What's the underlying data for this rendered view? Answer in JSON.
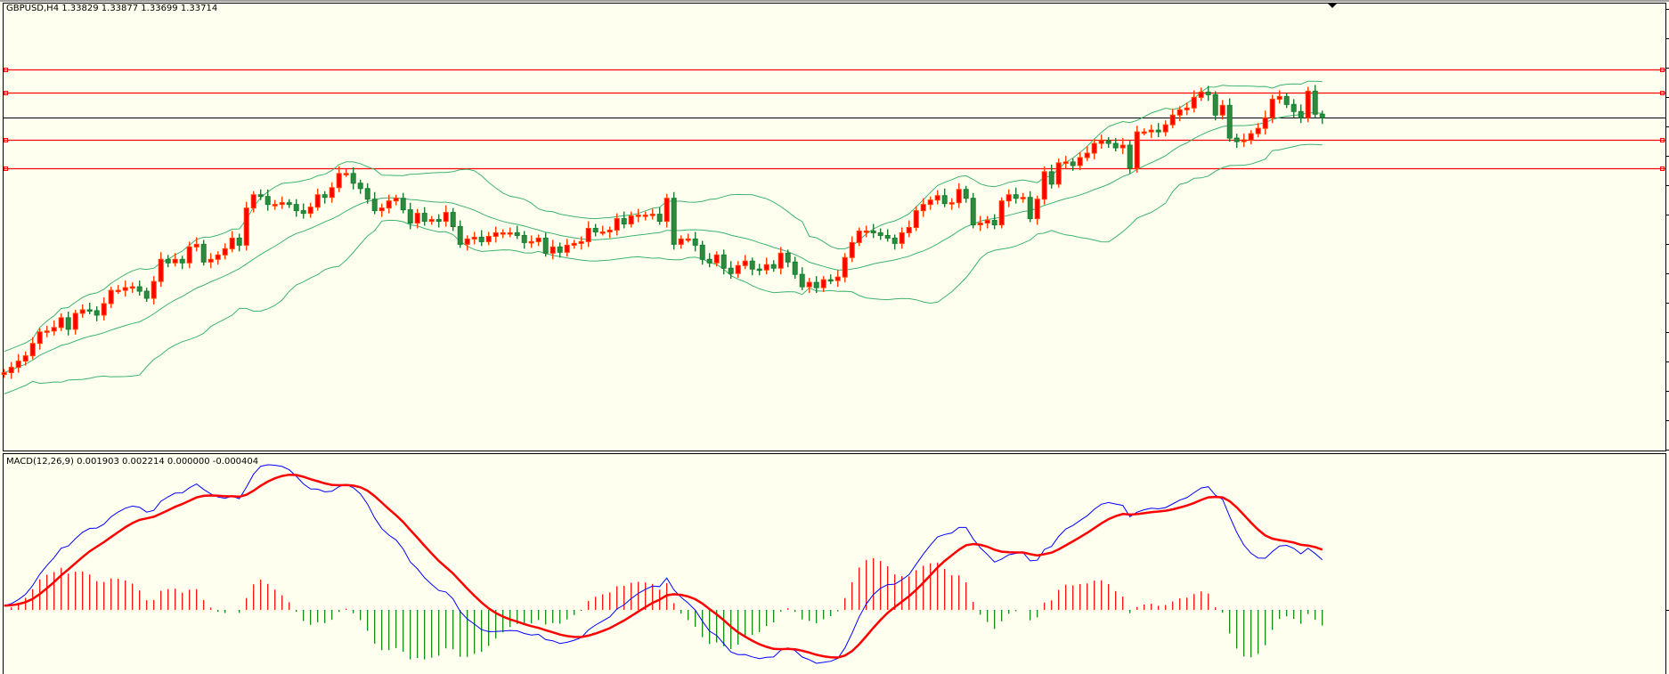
{
  "chart_data": {
    "type": "candlestick",
    "symbol_header": "GBPUSD,H4  1.33829 1.33877 1.33699 1.33714",
    "symbol": "GBPUSD",
    "timeframe": "H4",
    "ohlc_last": {
      "open": 1.33829,
      "high": 1.33877,
      "low": 1.33699,
      "close": 1.33714
    },
    "first_open": 1.3081,
    "closes": [
      1.3083,
      1.3089,
      1.3096,
      1.3102,
      1.3116,
      1.3129,
      1.313,
      1.3134,
      1.3145,
      1.3132,
      1.315,
      1.3154,
      1.3153,
      1.3148,
      1.3161,
      1.3176,
      1.3176,
      1.3179,
      1.318,
      1.3175,
      1.3167,
      1.3186,
      1.3211,
      1.3207,
      1.3211,
      1.3207,
      1.3225,
      1.3228,
      1.3208,
      1.3211,
      1.3216,
      1.3223,
      1.3235,
      1.3227,
      1.3269,
      1.3284,
      1.3282,
      1.3273,
      1.3273,
      1.3275,
      1.3273,
      1.3266,
      1.3263,
      1.327,
      1.3284,
      1.3281,
      1.3292,
      1.3308,
      1.3308,
      1.3297,
      1.3291,
      1.3279,
      1.3266,
      1.3269,
      1.3277,
      1.328,
      1.3267,
      1.3252,
      1.3263,
      1.3254,
      1.3256,
      1.3254,
      1.3264,
      1.3248,
      1.3228,
      1.3234,
      1.3236,
      1.3231,
      1.3237,
      1.3241,
      1.3241,
      1.3241,
      1.3238,
      1.323,
      1.3231,
      1.3235,
      1.3218,
      1.3225,
      1.3219,
      1.3227,
      1.3229,
      1.3231,
      1.3246,
      1.3242,
      1.3242,
      1.3244,
      1.3257,
      1.3251,
      1.326,
      1.3261,
      1.3261,
      1.3262,
      1.3254,
      1.328,
      1.3228,
      1.3234,
      1.3234,
      1.3227,
      1.3211,
      1.3207,
      1.3216,
      1.3201,
      1.3195,
      1.3204,
      1.3209,
      1.32,
      1.3199,
      1.3205,
      1.3201,
      1.3218,
      1.3208,
      1.3194,
      1.318,
      1.3185,
      1.3179,
      1.3188,
      1.3187,
      1.3191,
      1.3213,
      1.323,
      1.3243,
      1.3243,
      1.3241,
      1.3238,
      1.3235,
      1.3229,
      1.3241,
      1.3247,
      1.3266,
      1.3273,
      1.3278,
      1.3283,
      1.3274,
      1.3275,
      1.329,
      1.328,
      1.325,
      1.3252,
      1.3255,
      1.325,
      1.3277,
      1.3284,
      1.328,
      1.3281,
      1.3257,
      1.3279,
      1.331,
      1.3296,
      1.332,
      1.3321,
      1.3317,
      1.3326,
      1.3331,
      1.3342,
      1.3345,
      1.3342,
      1.3337,
      1.334,
      1.3314,
      1.3355,
      1.3355,
      1.3357,
      1.3355,
      1.3363,
      1.3374,
      1.338,
      1.3382,
      1.3394,
      1.34,
      1.3397,
      1.3374,
      1.3385,
      1.3348,
      1.3344,
      1.3346,
      1.3353,
      1.3359,
      1.3371,
      1.3392,
      1.3395,
      1.3386,
      1.3378,
      1.3371,
      1.3401,
      1.3375,
      1.3371
    ],
    "price_range": [
      1.2995,
      1.35
    ],
    "horizontal_lines": [
      {
        "price": 1.3426,
        "color": "#ff0000"
      },
      {
        "price": 1.3399,
        "color": "#ff0000"
      },
      {
        "price": 1.3346,
        "color": "#ff0000"
      },
      {
        "price": 1.3314,
        "color": "#ff0000"
      }
    ],
    "bid_line": {
      "price": 1.3371,
      "color": "#000000"
    },
    "indicators": {
      "bollinger": {
        "period": 20,
        "deviation": 2,
        "color": "#3cb371"
      },
      "macd": {
        "label": "MACD(12,26,9) 0.001903 0.002214 0.000000 -0.000404",
        "fast": 12,
        "slow": 26,
        "signal": 9,
        "values": [
          0.001903,
          0.002214,
          0.0,
          -0.000404
        ],
        "main_color": "#0000ff",
        "signal_color": "#ff0000",
        "hist_up_color": "#ff0000",
        "hist_down_color": "#008000"
      }
    },
    "colors": {
      "bull": "#ff0000",
      "bull_border": "#ff4000",
      "bear": "#2e8b3e",
      "bear_border": "#1f7a2e",
      "background": "#fffff0"
    }
  }
}
